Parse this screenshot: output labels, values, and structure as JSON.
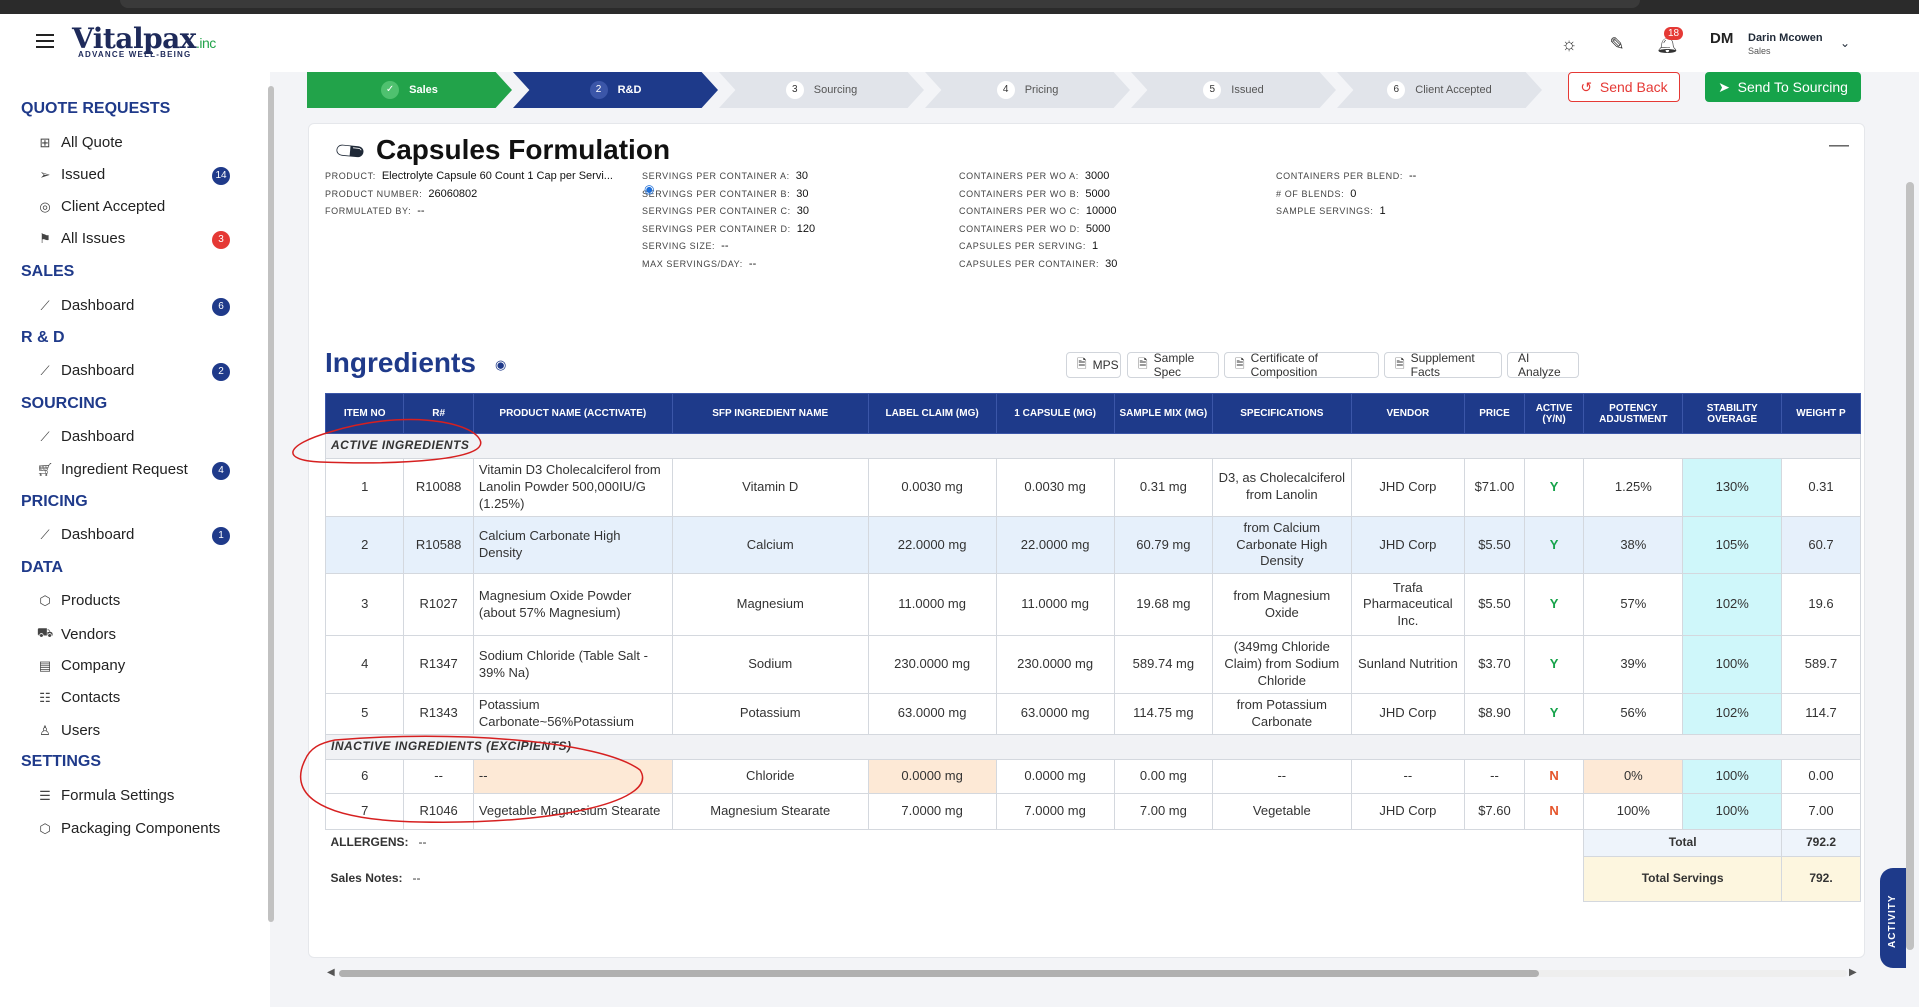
{
  "app": {
    "logo": "Vitalpax",
    "logo_suffix": ".inc",
    "tagline": "ADVANCE WELL-BEING"
  },
  "user": {
    "initials": "DM",
    "name": "Darin Mcowen",
    "role": "Sales",
    "notifications": "18"
  },
  "sidebar": {
    "sections": [
      {
        "title": "QUOTE REQUESTS",
        "items": [
          {
            "label": "All Quote",
            "icon": "grid-icon"
          },
          {
            "label": "Issued",
            "icon": "send-icon",
            "badge": "14"
          },
          {
            "label": "Client Accepted",
            "icon": "check-circle-icon"
          },
          {
            "label": "All Issues",
            "icon": "flag-icon",
            "badge": "3",
            "badge_color": "#e53935"
          }
        ]
      },
      {
        "title": "SALES",
        "items": [
          {
            "label": "Dashboard",
            "icon": "chart-icon",
            "badge": "6"
          }
        ]
      },
      {
        "title": "R & D",
        "items": [
          {
            "label": "Dashboard",
            "icon": "chart-icon",
            "badge": "2"
          }
        ]
      },
      {
        "title": "SOURCING",
        "items": [
          {
            "label": "Dashboard",
            "icon": "chart-icon"
          },
          {
            "label": "Ingredient Request",
            "icon": "cart-icon",
            "badge": "4"
          }
        ]
      },
      {
        "title": "PRICING",
        "items": [
          {
            "label": "Dashboard",
            "icon": "chart-icon",
            "badge": "1"
          }
        ]
      },
      {
        "title": "DATA",
        "items": [
          {
            "label": "Products",
            "icon": "box-icon"
          },
          {
            "label": "Vendors",
            "icon": "truck-icon"
          },
          {
            "label": "Company",
            "icon": "building-icon"
          },
          {
            "label": "Contacts",
            "icon": "contacts-icon"
          },
          {
            "label": "Users",
            "icon": "user-icon"
          }
        ]
      },
      {
        "title": "SETTINGS",
        "items": [
          {
            "label": "Formula Settings",
            "icon": "list-icon"
          },
          {
            "label": "Packaging Components",
            "icon": "box-icon"
          }
        ]
      }
    ]
  },
  "steps": [
    {
      "num": "",
      "label": "Sales",
      "state": "done"
    },
    {
      "num": "2",
      "label": "R&D",
      "state": "active"
    },
    {
      "num": "3",
      "label": "Sourcing",
      "state": "todo"
    },
    {
      "num": "4",
      "label": "Pricing",
      "state": "todo"
    },
    {
      "num": "5",
      "label": "Issued",
      "state": "todo"
    },
    {
      "num": "6",
      "label": "Client Accepted",
      "state": "todo"
    }
  ],
  "actions": {
    "send_back": "Send Back",
    "send_sourcing": "Send To Sourcing"
  },
  "formulation": {
    "title": "Capsules Formulation",
    "meta_col1": [
      {
        "k": "PRODUCT:",
        "v": "Electrolyte Capsule 60 Count 1 Cap per Servi..."
      },
      {
        "k": "PRODUCT NUMBER:",
        "v": "26060802"
      },
      {
        "k": "FORMULATED BY:",
        "v": "--"
      }
    ],
    "meta_col2": [
      {
        "k": "SERVINGS PER CONTAINER A:",
        "v": "30"
      },
      {
        "k": "SERVINGS PER CONTAINER B:",
        "v": "30"
      },
      {
        "k": "SERVINGS PER CONTAINER C:",
        "v": "30"
      },
      {
        "k": "SERVINGS PER CONTAINER D:",
        "v": "120"
      },
      {
        "k": "SERVING SIZE:",
        "v": "--"
      },
      {
        "k": "MAX SERVINGS/DAY:",
        "v": "--"
      }
    ],
    "meta_col3": [
      {
        "k": "CONTAINERS PER WO A:",
        "v": "3000"
      },
      {
        "k": "CONTAINERS PER WO B:",
        "v": "5000"
      },
      {
        "k": "CONTAINERS PER WO C:",
        "v": "10000"
      },
      {
        "k": "CONTAINERS PER WO D:",
        "v": "5000"
      },
      {
        "k": "CAPSULES PER SERVING:",
        "v": "1"
      },
      {
        "k": "CAPSULES PER CONTAINER:",
        "v": "30"
      }
    ],
    "meta_col4": [
      {
        "k": "CONTAINERS PER BLEND:",
        "v": "--"
      },
      {
        "k": "# OF BLENDS:",
        "v": "0"
      },
      {
        "k": "SAMPLE SERVINGS:",
        "v": "1"
      }
    ]
  },
  "ingredients": {
    "title": "Ingredients",
    "buttons": [
      "MPS",
      "Sample Spec",
      "Certificate of Composition",
      "Supplement Facts",
      "AI Analyze"
    ],
    "columns": [
      "ITEM NO",
      "R#",
      "PRODUCT NAME (ACCTIVATE)",
      "SFP INGREDIENT NAME",
      "LABEL CLAIM (MG)",
      "1 CAPSULE (MG)",
      "SAMPLE MIX (MG)",
      "SPECIFICATIONS",
      "VENDOR",
      "PRICE",
      "ACTIVE (Y/N)",
      "POTENCY ADJUSTMENT",
      "STABILITY OVERAGE",
      "WEIGHT P"
    ],
    "active_label": "ACTIVE INGREDIENTS",
    "inactive_label": "INACTIVE INGREDIENTS (EXCIPIENTS)",
    "active_rows": [
      [
        "1",
        "R10088",
        "Vitamin D3 Cholecalciferol from Lanolin Powder 500,000IU/G (1.25%)",
        "Vitamin D",
        "0.0030 mg",
        "0.0030 mg",
        "0.31 mg",
        "D3, as Cholecalciferol from Lanolin",
        "JHD Corp",
        "$71.00",
        "Y",
        "1.25%",
        "130%",
        "0.31"
      ],
      [
        "2",
        "R10588",
        "Calcium Carbonate High Density",
        "Calcium",
        "22.0000 mg",
        "22.0000 mg",
        "60.79 mg",
        "from Calcium Carbonate High Density",
        "JHD Corp",
        "$5.50",
        "Y",
        "38%",
        "105%",
        "60.7"
      ],
      [
        "3",
        "R1027",
        "Magnesium Oxide Powder (about 57% Magnesium)",
        "Magnesium",
        "11.0000 mg",
        "11.0000 mg",
        "19.68 mg",
        "from Magnesium Oxide",
        "Trafa Pharmaceutical Inc.",
        "$5.50",
        "Y",
        "57%",
        "102%",
        "19.6"
      ],
      [
        "4",
        "R1347",
        "Sodium Chloride (Table Salt - 39% Na)",
        "Sodium",
        "230.0000 mg",
        "230.0000 mg",
        "589.74 mg",
        "(349mg Chloride Claim) from Sodium Chloride",
        "Sunland Nutrition",
        "$3.70",
        "Y",
        "39%",
        "100%",
        "589.7"
      ],
      [
        "5",
        "R1343",
        "Potassium Carbonate~56%Potassium",
        "Potassium",
        "63.0000 mg",
        "63.0000 mg",
        "114.75 mg",
        "from Potassium Carbonate",
        "JHD Corp",
        "$8.90",
        "Y",
        "56%",
        "102%",
        "114.7"
      ]
    ],
    "inactive_rows": [
      [
        "6",
        "--",
        "--",
        "Chloride",
        "0.0000 mg",
        "0.0000 mg",
        "0.00 mg",
        "--",
        "--",
        "--",
        "N",
        "0%",
        "100%",
        "0.00"
      ],
      [
        "7",
        "R1046",
        "Vegetable Magnesium Stearate",
        "Magnesium Stearate",
        "7.0000 mg",
        "7.0000 mg",
        "7.00 mg",
        "Vegetable",
        "JHD Corp",
        "$7.60",
        "N",
        "100%",
        "100%",
        "7.00"
      ]
    ],
    "allergens_label": "ALLERGENS:",
    "allergens_value": "--",
    "sales_notes_label": "Sales Notes:",
    "sales_notes_value": "--",
    "total_label": "Total",
    "total_value": "792.2",
    "total_servings_label": "Total Servings",
    "total_servings_value": "792."
  },
  "activity_tab": "ACTIVITY"
}
